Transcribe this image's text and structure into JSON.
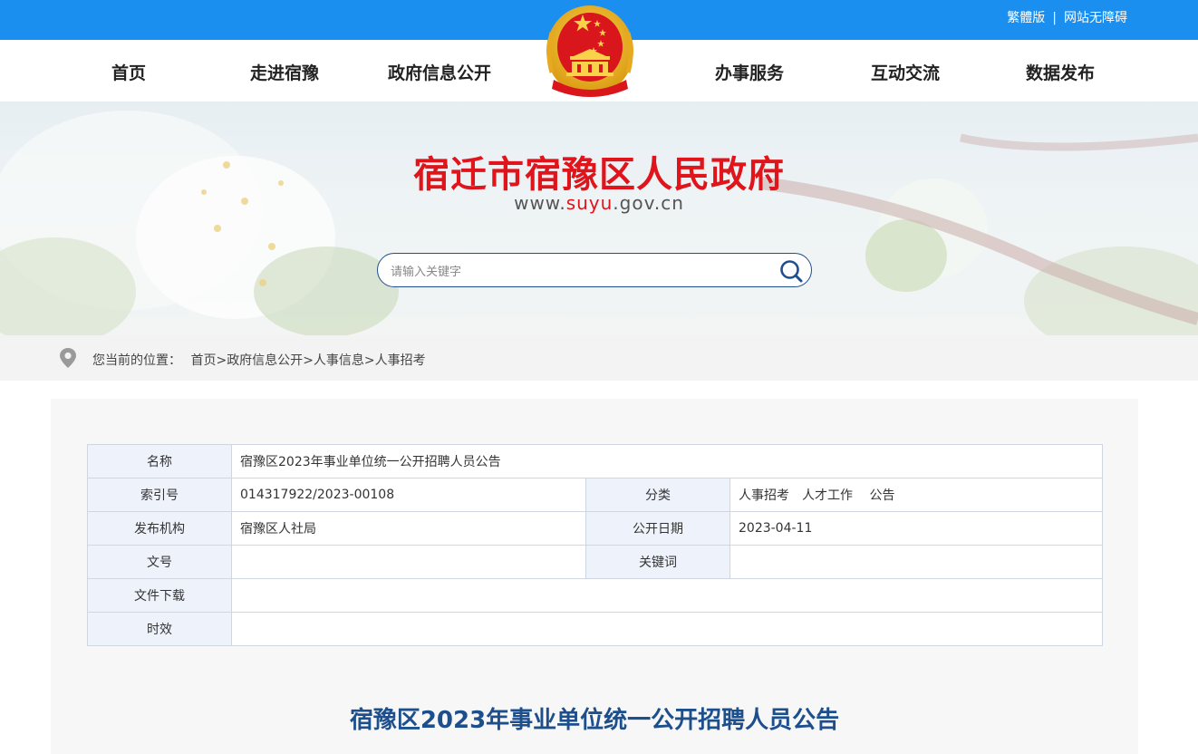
{
  "topbar": {
    "traditional": "繁體版",
    "separator": "|",
    "accessible": "网站无障碍",
    "color": "#1a8ff0"
  },
  "nav": {
    "items": [
      "首页",
      "走进宿豫",
      "政府信息公开",
      "办事服务",
      "互动交流",
      "数据发布"
    ]
  },
  "banner": {
    "title": "宿迁市宿豫区人民政府",
    "url_prefix": "www.",
    "url_domain": "suyu",
    "url_suffix": ".gov.cn",
    "title_color": "#e0141b"
  },
  "search": {
    "placeholder": "请输入关键字",
    "icon": "search-icon"
  },
  "breadcrumb": {
    "icon": "location-pin-icon",
    "label": "您当前的位置：",
    "items": [
      "首页",
      "政府信息公开",
      "人事信息",
      "人事招考"
    ],
    "sep": ">"
  },
  "meta": {
    "name_label": "名称",
    "name_value": "宿豫区2023年事业单位统一公开招聘人员公告",
    "index_label": "索引号",
    "index_value": "014317922/2023-00108",
    "category_label": "分类",
    "category_value": "人事招考　人才工作　 公告",
    "publisher_label": "发布机构",
    "publisher_value": "宿豫区人社局",
    "date_label": "公开日期",
    "date_value": "2023-04-11",
    "docno_label": "文号",
    "docno_value": "",
    "keywords_label": "关键词",
    "keywords_value": "",
    "download_label": "文件下载",
    "download_value": "",
    "validity_label": "时效",
    "validity_value": ""
  },
  "article": {
    "title": "宿豫区2023年事业单位统一公开招聘人员公告",
    "title_color": "#1d4f8c"
  }
}
